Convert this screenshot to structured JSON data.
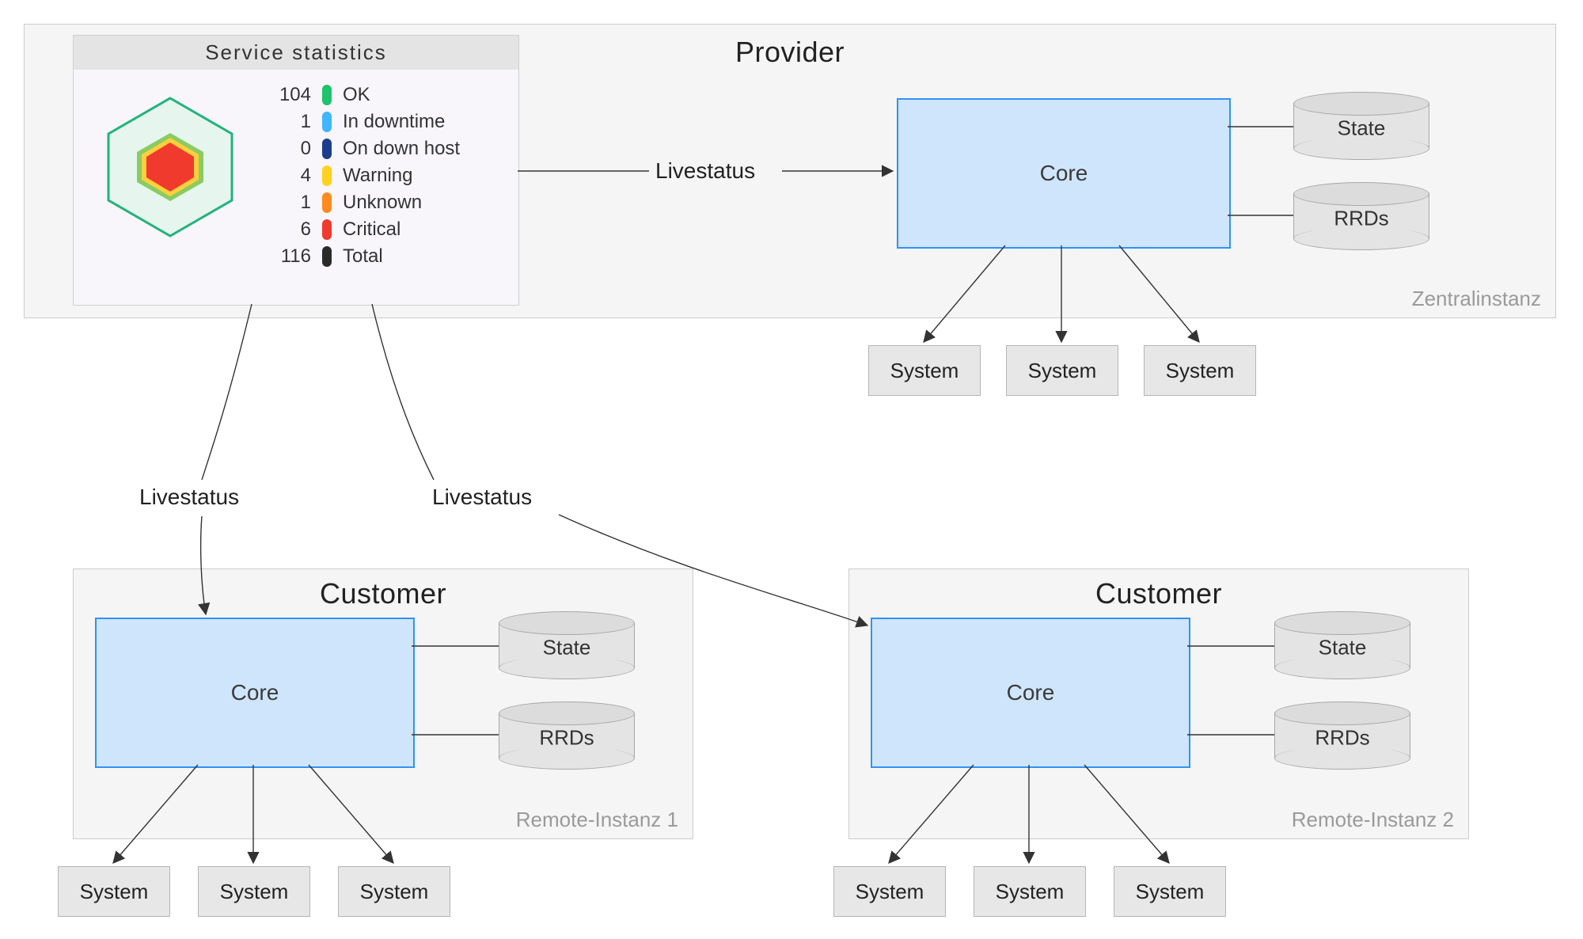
{
  "provider": {
    "title": "Provider",
    "sub": "Zentralinstanz",
    "core": "Core",
    "db_state": "State",
    "db_rrds": "RRDs",
    "systems": [
      "System",
      "System",
      "System"
    ]
  },
  "customer1": {
    "title": "Customer",
    "sub": "Remote-Instanz 1",
    "core": "Core",
    "db_state": "State",
    "db_rrds": "RRDs",
    "systems": [
      "System",
      "System",
      "System"
    ]
  },
  "customer2": {
    "title": "Customer",
    "sub": "Remote-Instanz 2",
    "core": "Core",
    "db_state": "State",
    "db_rrds": "RRDs",
    "systems": [
      "System",
      "System",
      "System"
    ]
  },
  "links": {
    "stats_to_provider": "Livestatus",
    "stats_to_c1": "Livestatus",
    "stats_to_c2": "Livestatus"
  },
  "stats": {
    "title": "Service statistics",
    "rows": [
      {
        "n": "104",
        "label": "OK",
        "color": "#1ec36b"
      },
      {
        "n": "1",
        "label": "In downtime",
        "color": "#3fb6ff"
      },
      {
        "n": "0",
        "label": "On down host",
        "color": "#1b3e8c"
      },
      {
        "n": "4",
        "label": "Warning",
        "color": "#ffd21f"
      },
      {
        "n": "1",
        "label": "Unknown",
        "color": "#ff8a1f"
      },
      {
        "n": "6",
        "label": "Critical",
        "color": "#f03a2d"
      },
      {
        "n": "116",
        "label": "Total",
        "color": "#2a2a2a"
      }
    ]
  }
}
